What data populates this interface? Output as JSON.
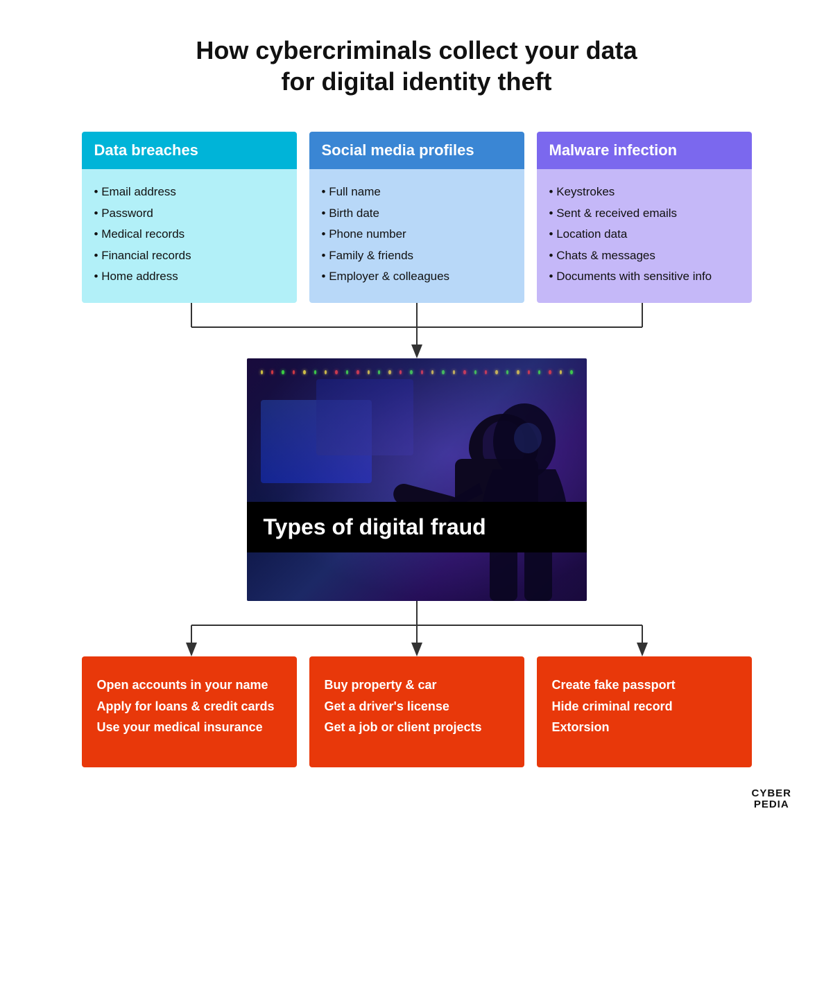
{
  "title": {
    "line1": "How cybercriminals collect your data",
    "line2": "for digital identity theft"
  },
  "top_boxes": [
    {
      "id": "data-breaches",
      "header": "Data breaches",
      "color_class": "box-cyan",
      "items": [
        "Email address",
        "Password",
        "Medical records",
        "Financial records",
        "Home address"
      ]
    },
    {
      "id": "social-media",
      "header": "Social media profiles",
      "color_class": "box-blue",
      "items": [
        "Full name",
        "Birth date",
        "Phone number",
        "Family & friends",
        "Employer & colleagues"
      ]
    },
    {
      "id": "malware",
      "header": "Malware infection",
      "color_class": "box-purple",
      "items": [
        "Keystrokes",
        "Sent & received emails",
        "Location data",
        "Chats & messages",
        "Documents with sensitive info"
      ]
    }
  ],
  "fraud_section_label": "Types of digital fraud",
  "bottom_boxes": [
    {
      "id": "financial-fraud",
      "items": [
        "Open accounts in your name",
        "Apply for loans & credit cards",
        "Use your medical insurance"
      ]
    },
    {
      "id": "property-fraud",
      "items": [
        "Buy property & car",
        "Get a driver's license",
        "Get a job or client projects"
      ]
    },
    {
      "id": "identity-fraud",
      "items": [
        "Create fake passport",
        "Hide criminal record",
        "Extorsion"
      ]
    }
  ],
  "logo": {
    "line1": "CYBER",
    "line2": "PEDIA"
  }
}
